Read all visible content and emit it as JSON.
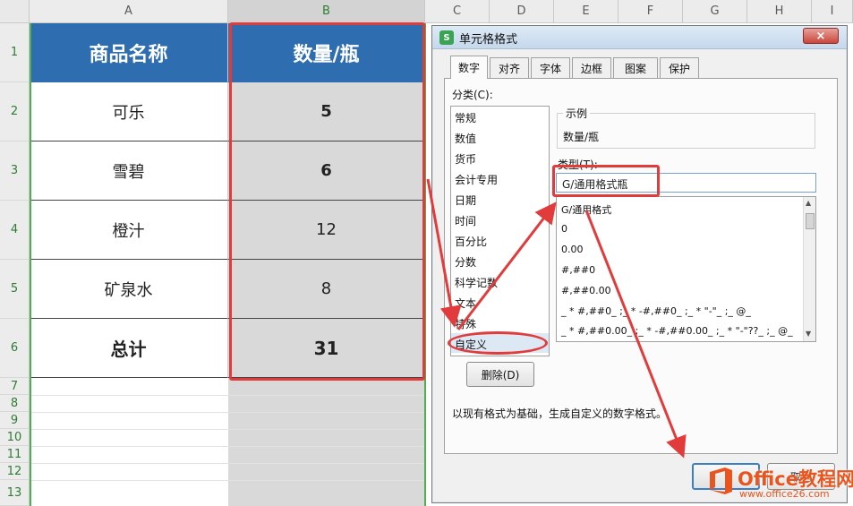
{
  "sheet": {
    "columns": [
      "A",
      "B",
      "C",
      "D",
      "E",
      "F",
      "G",
      "H",
      "I"
    ],
    "rows": [
      "1",
      "2",
      "3",
      "4",
      "5",
      "6",
      "7",
      "8",
      "9",
      "10",
      "11",
      "12",
      "13"
    ],
    "header": {
      "name": "商品名称",
      "qty": "数量/瓶"
    },
    "data": [
      {
        "name": "可乐",
        "qty": "5"
      },
      {
        "name": "雪碧",
        "qty": "6"
      },
      {
        "name": "橙汁",
        "qty": "12"
      },
      {
        "name": "矿泉水",
        "qty": "8"
      },
      {
        "name": "总计",
        "qty": "31"
      }
    ]
  },
  "dialog": {
    "title": "单元格格式",
    "close": "×",
    "tabs": [
      "数字",
      "对齐",
      "字体",
      "边框",
      "图案",
      "保护"
    ],
    "category_label": "分类(C):",
    "categories": [
      "常规",
      "数值",
      "货币",
      "会计专用",
      "日期",
      "时间",
      "百分比",
      "分数",
      "科学记数",
      "文本",
      "特殊",
      "自定义"
    ],
    "sample_label": "示例",
    "sample_value": "数量/瓶",
    "type_label": "类型(T):",
    "type_value": "G/通用格式瓶",
    "format_list": [
      "G/通用格式",
      "0",
      "0.00",
      "#,##0",
      "#,##0.00",
      "_ * #,##0_ ;_ * -#,##0_ ;_ * \"-\"_ ;_ @_",
      "_ * #,##0.00_ ;_ * -#,##0.00_ ;_ * \"-\"??_ ;_ @_"
    ],
    "delete_button": "删除(D)",
    "hint": "以现有格式为基础，生成自定义的数字格式。",
    "ok_button": "",
    "cancel_button": "取消"
  },
  "watermark": {
    "brand": "Office教程网",
    "url": "www.office26.com"
  },
  "colors": {
    "header_blue": "#2e6db0",
    "highlight_red": "#e23b3b",
    "selection_green": "#4caf50"
  }
}
